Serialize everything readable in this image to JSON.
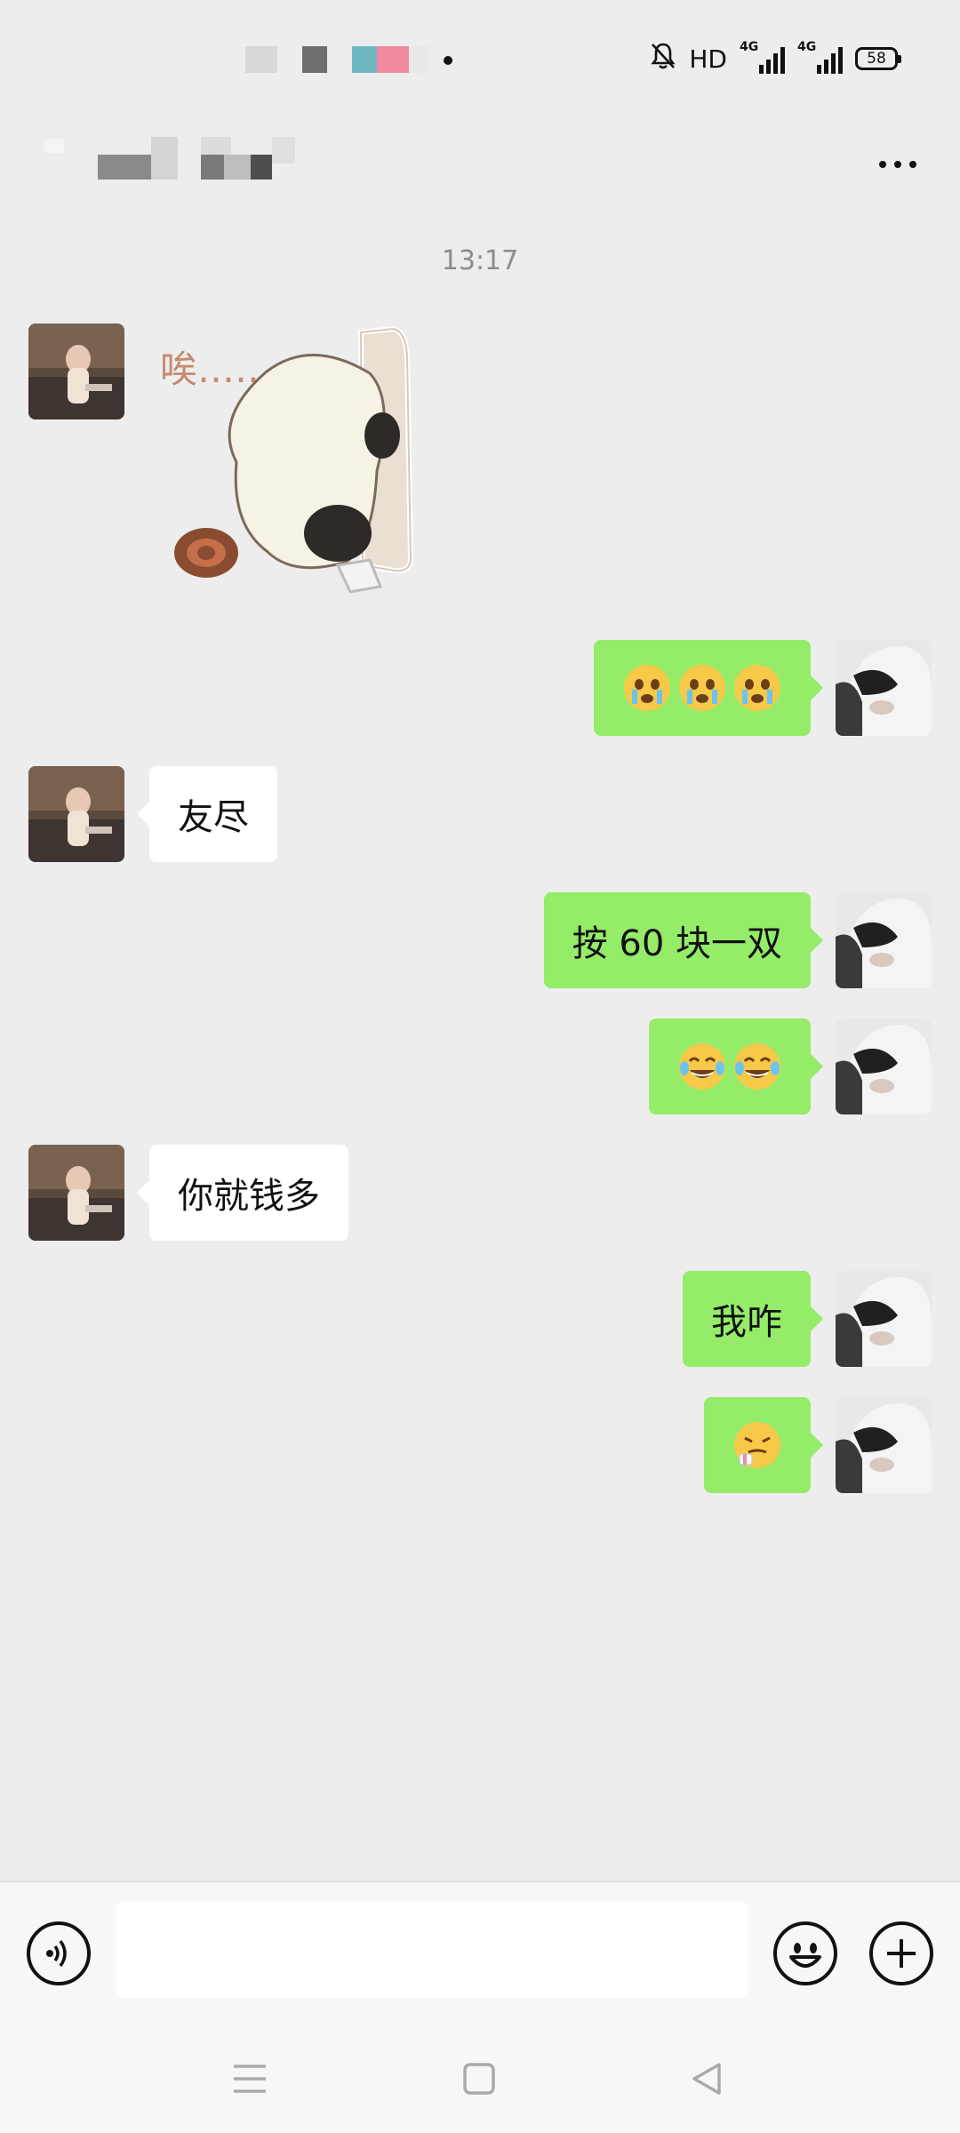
{
  "status_bar": {
    "network_label": "HD",
    "signal1_tag": "4G",
    "signal2_tag": "4G",
    "battery": "58"
  },
  "header": {
    "more_icon": "more-horizontal-icon"
  },
  "chat": {
    "timestamp": "13:17",
    "sticker_caption": "唉……",
    "messages": [
      {
        "side": "left",
        "type": "sticker",
        "sticker": "panda-hiding-sticker"
      },
      {
        "side": "right",
        "type": "emoji",
        "emoji": [
          "crying-face",
          "crying-face",
          "crying-face"
        ]
      },
      {
        "side": "left",
        "type": "text",
        "text": "友尽"
      },
      {
        "side": "right",
        "type": "text",
        "text": "按 60 块一双"
      },
      {
        "side": "right",
        "type": "emoji",
        "emoji": [
          "tears-of-joy",
          "tears-of-joy"
        ]
      },
      {
        "side": "left",
        "type": "text",
        "text": "你就钱多"
      },
      {
        "side": "right",
        "type": "text",
        "text": "我咋"
      },
      {
        "side": "right",
        "type": "emoji",
        "emoji": [
          "sick-face"
        ]
      }
    ]
  },
  "input_bar": {
    "voice_icon": "voice-icon",
    "input_value": "",
    "input_placeholder": "",
    "emoji_icon": "emoji-icon",
    "add_icon": "plus-icon"
  },
  "colors": {
    "background": "#ededed",
    "self_bubble": "#95ec69",
    "other_bubble": "#ffffff"
  }
}
